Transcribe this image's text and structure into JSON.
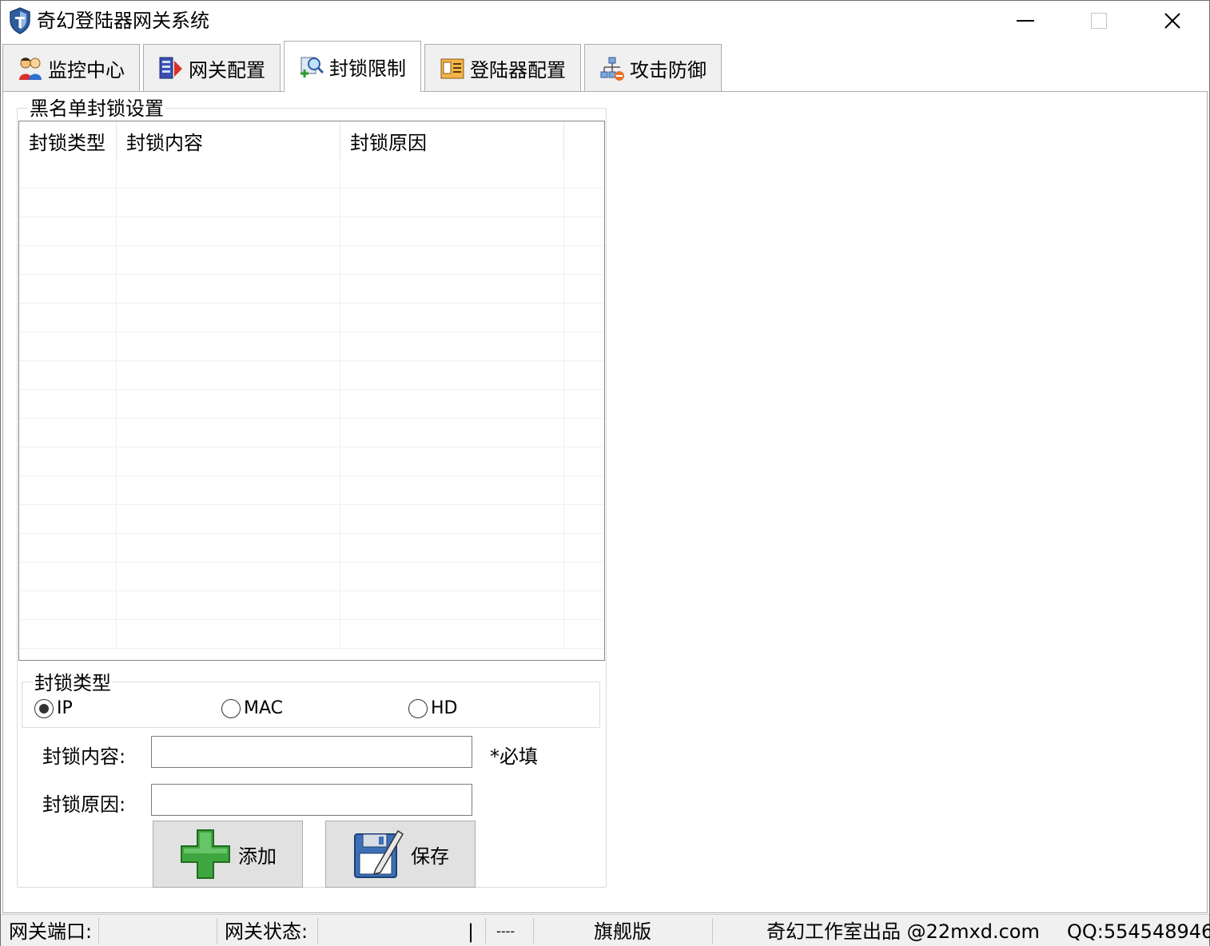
{
  "window": {
    "title": "奇幻登陆器网关系统"
  },
  "tabs": [
    {
      "label": "监控中心",
      "icon": "users-icon"
    },
    {
      "label": "网关配置",
      "icon": "gateway-config-icon"
    },
    {
      "label": "封锁限制",
      "icon": "search-block-icon",
      "active": true
    },
    {
      "label": "登陆器配置",
      "icon": "launcher-config-icon"
    },
    {
      "label": "攻击防御",
      "icon": "network-defense-icon"
    }
  ],
  "blacklist": {
    "group_title": "黑名单封锁设置",
    "columns": [
      "封锁类型",
      "封锁内容",
      "封锁原因"
    ],
    "rows": []
  },
  "block_type": {
    "group_title": "封锁类型",
    "options": [
      {
        "label": "IP",
        "checked": true
      },
      {
        "label": "MAC",
        "checked": false
      },
      {
        "label": "HD",
        "checked": false
      }
    ]
  },
  "form": {
    "content_label": "封锁内容:",
    "content_value": "",
    "required_note": "*必填",
    "reason_label": "封锁原因:",
    "reason_value": ""
  },
  "buttons": {
    "add_label": "添加",
    "save_label": "保存"
  },
  "statusbar": {
    "port_label": "网关端口:",
    "port_value": "",
    "state_label": "网关状态:",
    "state_value": "",
    "pipe": "|",
    "dashes": "----",
    "edition": "旗舰版",
    "credit": "奇幻工作室出品 @22mxd.com",
    "qq": "QQ:554548946"
  },
  "colors": {
    "accent_green": "#3fa63f",
    "tab_bg": "#f0f0f0",
    "border": "#adadad"
  }
}
